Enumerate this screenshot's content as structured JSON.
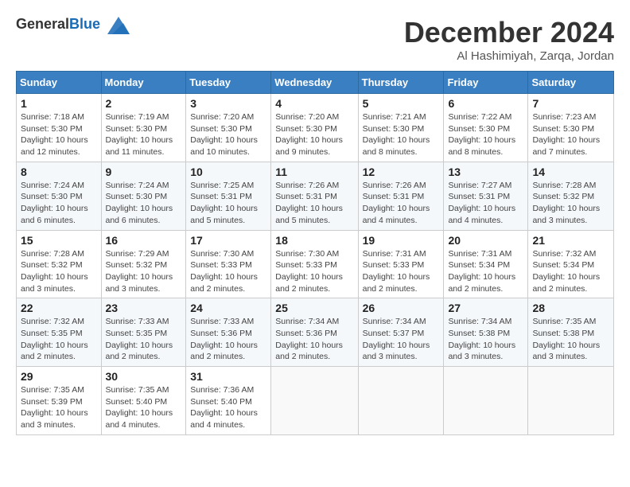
{
  "header": {
    "logo_general": "General",
    "logo_blue": "Blue",
    "month_title": "December 2024",
    "location": "Al Hashimiyah, Zarqa, Jordan"
  },
  "weekdays": [
    "Sunday",
    "Monday",
    "Tuesday",
    "Wednesday",
    "Thursday",
    "Friday",
    "Saturday"
  ],
  "weeks": [
    [
      {
        "day": "1",
        "info": "Sunrise: 7:18 AM\nSunset: 5:30 PM\nDaylight: 10 hours\nand 12 minutes."
      },
      {
        "day": "2",
        "info": "Sunrise: 7:19 AM\nSunset: 5:30 PM\nDaylight: 10 hours\nand 11 minutes."
      },
      {
        "day": "3",
        "info": "Sunrise: 7:20 AM\nSunset: 5:30 PM\nDaylight: 10 hours\nand 10 minutes."
      },
      {
        "day": "4",
        "info": "Sunrise: 7:20 AM\nSunset: 5:30 PM\nDaylight: 10 hours\nand 9 minutes."
      },
      {
        "day": "5",
        "info": "Sunrise: 7:21 AM\nSunset: 5:30 PM\nDaylight: 10 hours\nand 8 minutes."
      },
      {
        "day": "6",
        "info": "Sunrise: 7:22 AM\nSunset: 5:30 PM\nDaylight: 10 hours\nand 8 minutes."
      },
      {
        "day": "7",
        "info": "Sunrise: 7:23 AM\nSunset: 5:30 PM\nDaylight: 10 hours\nand 7 minutes."
      }
    ],
    [
      {
        "day": "8",
        "info": "Sunrise: 7:24 AM\nSunset: 5:30 PM\nDaylight: 10 hours\nand 6 minutes."
      },
      {
        "day": "9",
        "info": "Sunrise: 7:24 AM\nSunset: 5:30 PM\nDaylight: 10 hours\nand 6 minutes."
      },
      {
        "day": "10",
        "info": "Sunrise: 7:25 AM\nSunset: 5:31 PM\nDaylight: 10 hours\nand 5 minutes."
      },
      {
        "day": "11",
        "info": "Sunrise: 7:26 AM\nSunset: 5:31 PM\nDaylight: 10 hours\nand 5 minutes."
      },
      {
        "day": "12",
        "info": "Sunrise: 7:26 AM\nSunset: 5:31 PM\nDaylight: 10 hours\nand 4 minutes."
      },
      {
        "day": "13",
        "info": "Sunrise: 7:27 AM\nSunset: 5:31 PM\nDaylight: 10 hours\nand 4 minutes."
      },
      {
        "day": "14",
        "info": "Sunrise: 7:28 AM\nSunset: 5:32 PM\nDaylight: 10 hours\nand 3 minutes."
      }
    ],
    [
      {
        "day": "15",
        "info": "Sunrise: 7:28 AM\nSunset: 5:32 PM\nDaylight: 10 hours\nand 3 minutes."
      },
      {
        "day": "16",
        "info": "Sunrise: 7:29 AM\nSunset: 5:32 PM\nDaylight: 10 hours\nand 3 minutes."
      },
      {
        "day": "17",
        "info": "Sunrise: 7:30 AM\nSunset: 5:33 PM\nDaylight: 10 hours\nand 2 minutes."
      },
      {
        "day": "18",
        "info": "Sunrise: 7:30 AM\nSunset: 5:33 PM\nDaylight: 10 hours\nand 2 minutes."
      },
      {
        "day": "19",
        "info": "Sunrise: 7:31 AM\nSunset: 5:33 PM\nDaylight: 10 hours\nand 2 minutes."
      },
      {
        "day": "20",
        "info": "Sunrise: 7:31 AM\nSunset: 5:34 PM\nDaylight: 10 hours\nand 2 minutes."
      },
      {
        "day": "21",
        "info": "Sunrise: 7:32 AM\nSunset: 5:34 PM\nDaylight: 10 hours\nand 2 minutes."
      }
    ],
    [
      {
        "day": "22",
        "info": "Sunrise: 7:32 AM\nSunset: 5:35 PM\nDaylight: 10 hours\nand 2 minutes."
      },
      {
        "day": "23",
        "info": "Sunrise: 7:33 AM\nSunset: 5:35 PM\nDaylight: 10 hours\nand 2 minutes."
      },
      {
        "day": "24",
        "info": "Sunrise: 7:33 AM\nSunset: 5:36 PM\nDaylight: 10 hours\nand 2 minutes."
      },
      {
        "day": "25",
        "info": "Sunrise: 7:34 AM\nSunset: 5:36 PM\nDaylight: 10 hours\nand 2 minutes."
      },
      {
        "day": "26",
        "info": "Sunrise: 7:34 AM\nSunset: 5:37 PM\nDaylight: 10 hours\nand 3 minutes."
      },
      {
        "day": "27",
        "info": "Sunrise: 7:34 AM\nSunset: 5:38 PM\nDaylight: 10 hours\nand 3 minutes."
      },
      {
        "day": "28",
        "info": "Sunrise: 7:35 AM\nSunset: 5:38 PM\nDaylight: 10 hours\nand 3 minutes."
      }
    ],
    [
      {
        "day": "29",
        "info": "Sunrise: 7:35 AM\nSunset: 5:39 PM\nDaylight: 10 hours\nand 3 minutes."
      },
      {
        "day": "30",
        "info": "Sunrise: 7:35 AM\nSunset: 5:40 PM\nDaylight: 10 hours\nand 4 minutes."
      },
      {
        "day": "31",
        "info": "Sunrise: 7:36 AM\nSunset: 5:40 PM\nDaylight: 10 hours\nand 4 minutes."
      },
      null,
      null,
      null,
      null
    ]
  ]
}
